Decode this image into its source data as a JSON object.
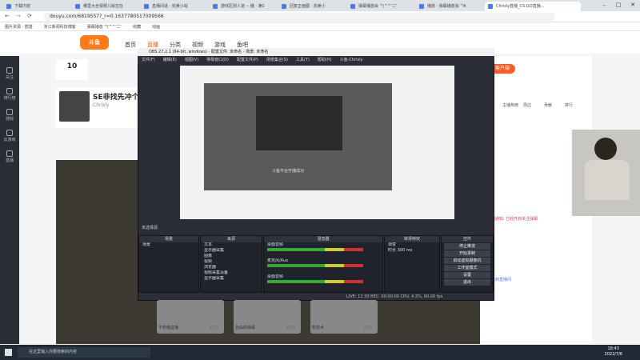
{
  "browser": {
    "tabs": [
      {
        "label": "下载内容"
      },
      {
        "label": "哪里大全视频儿就在在"
      },
      {
        "label": "直播间话 · 完美小站"
      },
      {
        "label": "游戏区别人道 -- 播 · 满1"
      },
      {
        "label": "回复正面图 · 完美小"
      },
      {
        "label": "弹幕播放会 '\"(^^'二'"
      },
      {
        "label": "播放 · 弹幕播放会 '\"A"
      },
      {
        "label": "Chrisly直播_CS:GO直播..."
      }
    ],
    "url": "douyu.com/6819557?_r=0.1637780517009566",
    "bookmarks": [
      "图片资源 · 部落",
      "浙江新闻科技博客",
      "弹幕播放 '\"(^^'二'",
      "收藏",
      "动画"
    ]
  },
  "site": {
    "logo": "斗鱼",
    "nav": [
      "首页",
      "直播",
      "分类",
      "视频",
      "游戏",
      "鱼吧"
    ],
    "rail": [
      "关注",
      "排行榜",
      "游戏",
      "云游戏",
      "直播"
    ],
    "room_title": "SE非找先冲个箭1",
    "host_name": "Chrisly",
    "followers": "10",
    "right_tabs": [
      "主播热榜",
      "周边",
      "贡献",
      "排行"
    ],
    "right_button": "PC客户端",
    "notice": "直播间通知: 已经开启关注弹幕",
    "chat_overlay": "欢迎来到直播间",
    "thumbs": [
      {
        "title": "不想唱直播",
        "views": "17万"
      },
      {
        "title": "自由的弹幕",
        "views": "15万"
      },
      {
        "title": "新技术",
        "views": "21万"
      }
    ]
  },
  "obs": {
    "title": "OBS 27.2.1 (64-bit, windows) - 配置文件: 未命名 - 场景: 未命名",
    "menu": [
      "文件(F)",
      "编辑(E)",
      "视图(V)",
      "停靠窗口(D)",
      "配置文件(P)",
      "场景集合(S)",
      "工具(T)",
      "帮助(H)",
      "斗鱼-Chrisly"
    ],
    "scenebar": "未选择源",
    "preview_caption": "斗鱼平台开播成功",
    "docks": {
      "scenes": {
        "title": "场景",
        "items": [
          "场景"
        ]
      },
      "sources": {
        "title": "来源",
        "items": [
          "文本",
          "显示器采集",
          "图像",
          "视频",
          "浏览器",
          "视频采集设备",
          "显示器采集"
        ]
      },
      "mixer": {
        "title": "混音器",
        "items": [
          "桌面音频",
          "麦克风/Aux",
          "桌面音频"
        ]
      },
      "transitions": {
        "title": "转场特效",
        "fade": "渐变",
        "duration_label": "时长",
        "duration": "300 ms"
      },
      "controls": {
        "title": "控件",
        "buttons": [
          "停止推流",
          "开始录制",
          "启动虚拟摄像机",
          "工作室模式",
          "设置",
          "退出"
        ]
      }
    },
    "status": "LIVE: 12:30   REC: 00:00:00   CPU: 4.3%, 60.00 fps"
  },
  "taskbar": {
    "search": "在这里输入你要搜索的内容",
    "time": "18:43",
    "date": "2022/7/6"
  }
}
